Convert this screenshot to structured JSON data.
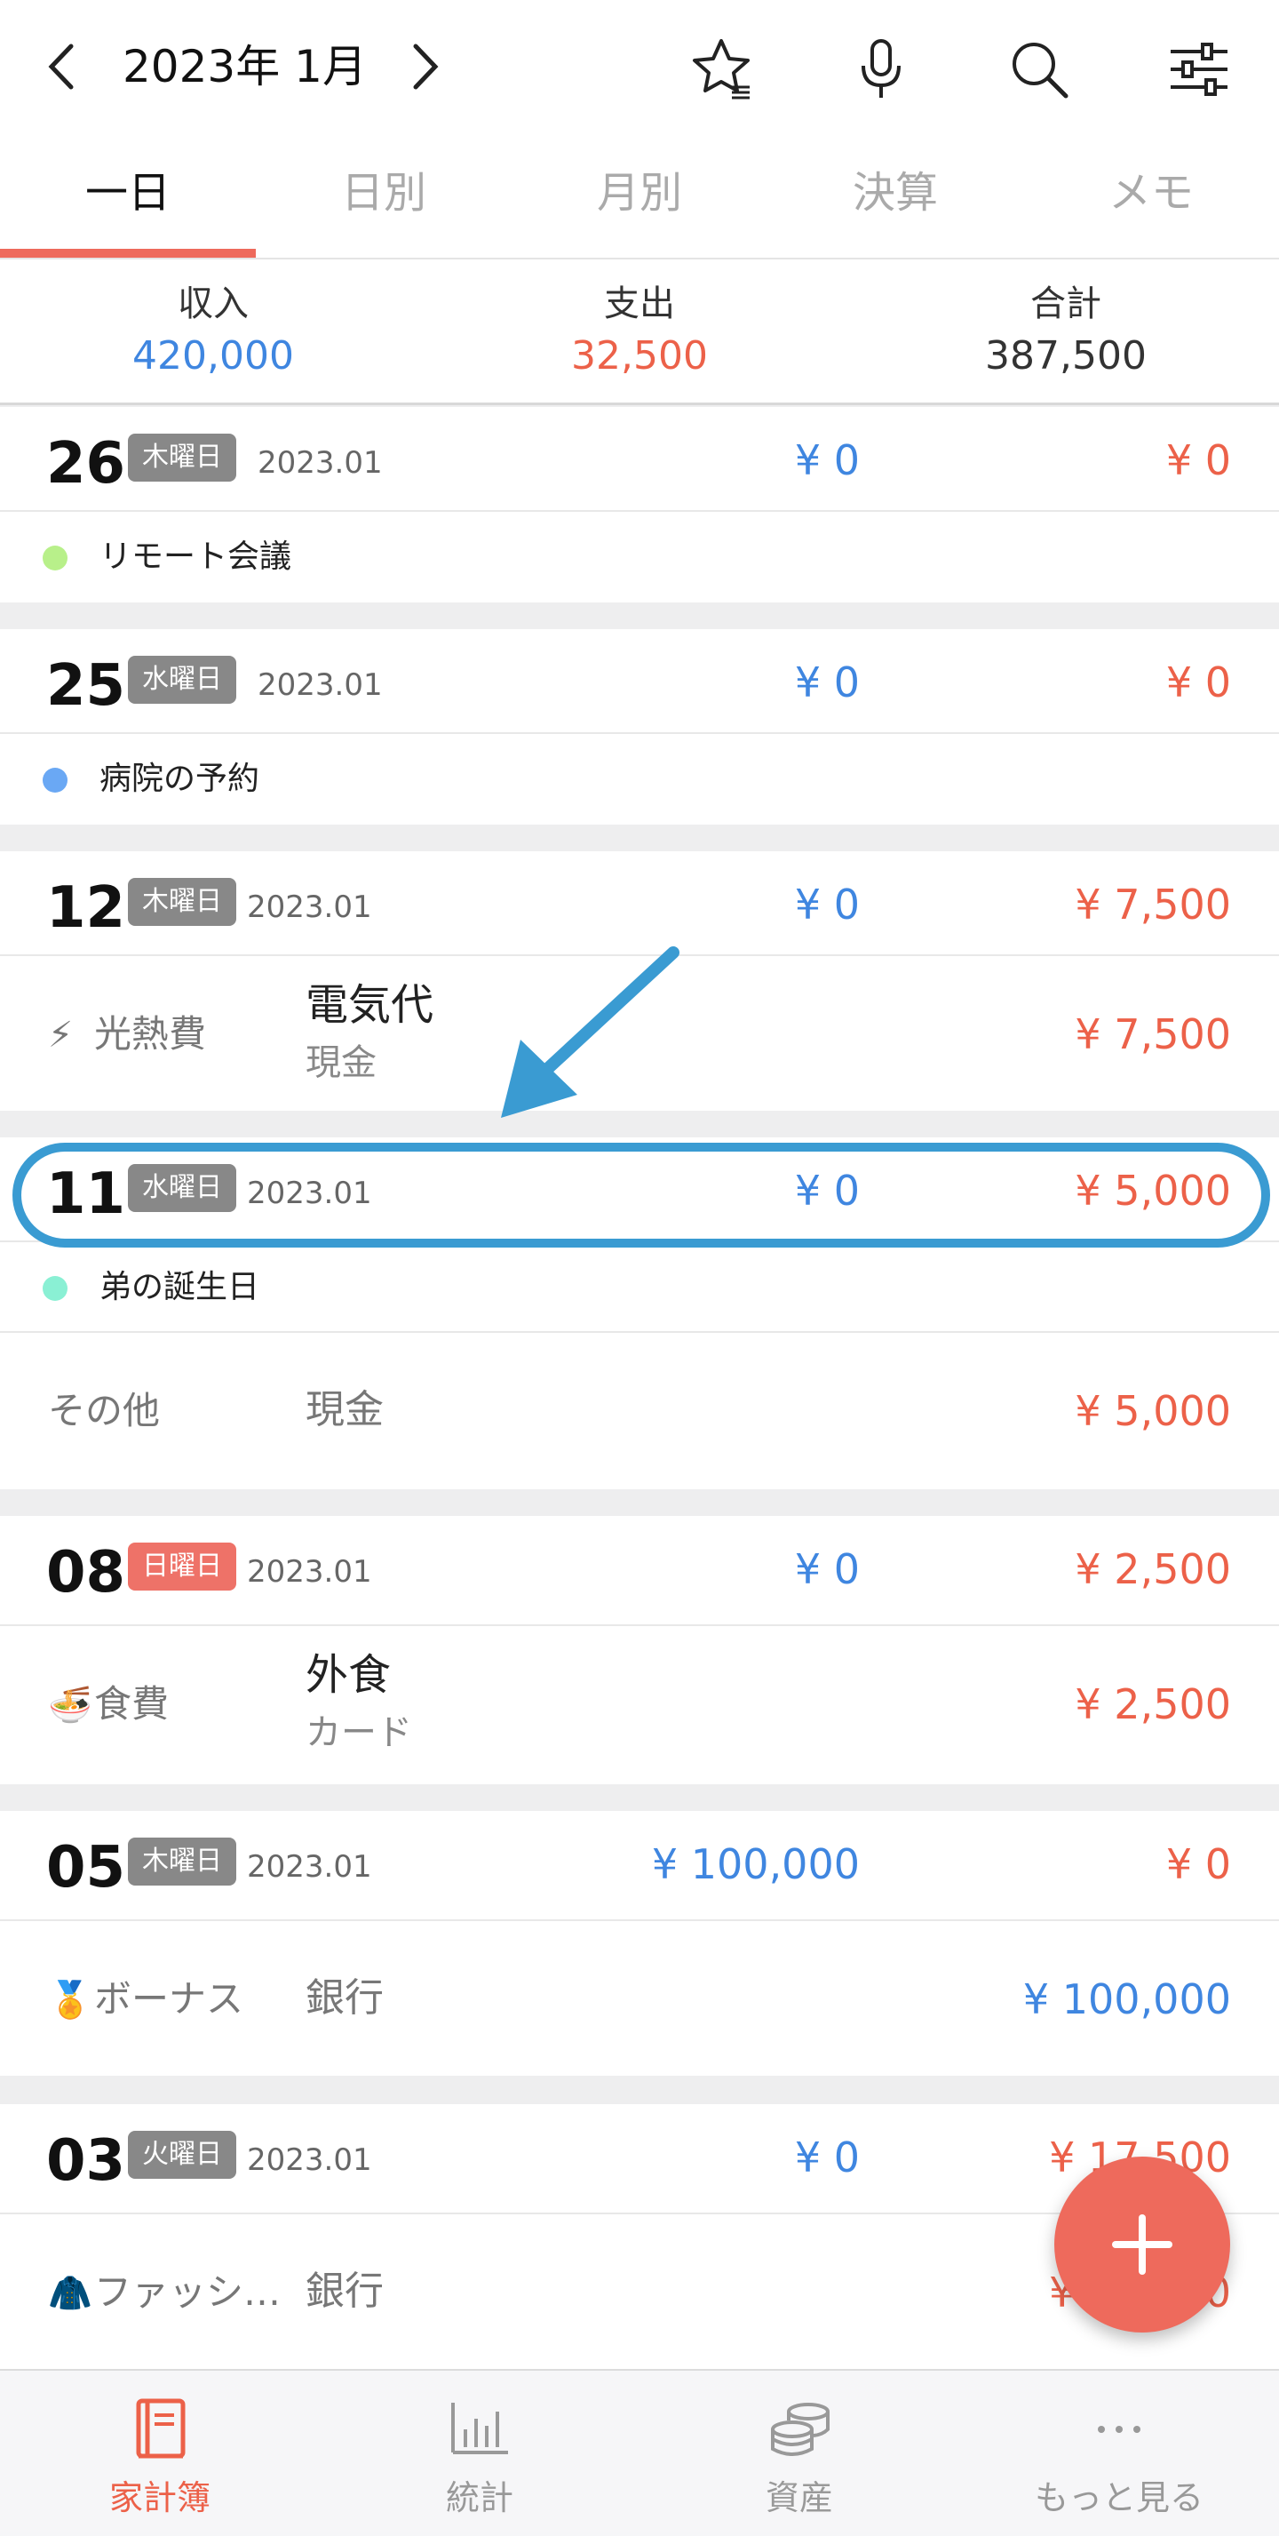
{
  "header": {
    "month": "2023年 1月"
  },
  "tabs": [
    {
      "label": "一日",
      "active": true
    },
    {
      "label": "日別",
      "active": false
    },
    {
      "label": "月別",
      "active": false
    },
    {
      "label": "決算",
      "active": false
    },
    {
      "label": "メモ",
      "active": false
    }
  ],
  "summary": {
    "income_label": "収入",
    "income": "420,000",
    "expense_label": "支出",
    "expense": "32,500",
    "total_label": "合計",
    "total": "387,500"
  },
  "days": [
    {
      "day": "26",
      "weekday": "木曜日",
      "ym": "2023.01",
      "income": "¥ 0",
      "expense": "¥ 0",
      "memo": {
        "text": "リモート会議",
        "color": "#b8f08a"
      }
    },
    {
      "day": "25",
      "weekday": "水曜日",
      "ym": "2023.01",
      "income": "¥ 0",
      "expense": "¥ 0",
      "memo": {
        "text": "病院の予約",
        "color": "#6aa8f4"
      }
    },
    {
      "day": "12",
      "weekday": "木曜日",
      "ym": "2023.01",
      "income": "¥ 0",
      "expense": "¥ 7,500",
      "tx": {
        "icon": "⚡",
        "category": "光熱費",
        "title": "電気代",
        "account": "現金",
        "amount": "¥ 7,500"
      }
    },
    {
      "day": "11",
      "weekday": "水曜日",
      "ym": "2023.01",
      "income": "¥ 0",
      "expense": "¥ 5,000",
      "memo": {
        "text": "弟の誕生日",
        "color": "#8af0d4"
      },
      "tx": {
        "category": "その他",
        "account": "現金",
        "amount": "¥ 5,000"
      }
    },
    {
      "day": "08",
      "weekday": "日曜日",
      "ym": "2023.01",
      "income": "¥ 0",
      "expense": "¥ 2,500",
      "tx": {
        "icon": "🍜",
        "category": "食費",
        "title": "外食",
        "account": "カード",
        "amount": "¥ 2,500"
      }
    },
    {
      "day": "05",
      "weekday": "木曜日",
      "ym": "2023.01",
      "income": "¥ 100,000",
      "expense": "¥ 0",
      "tx": {
        "icon": "🏅",
        "category": "ボーナス",
        "account": "銀行",
        "amount": "¥ 100,000"
      }
    },
    {
      "day": "03",
      "weekday": "火曜日",
      "ym": "2023.01",
      "income": "¥ 0",
      "expense": "¥ 17,500",
      "tx": {
        "icon": "🧥",
        "category": "ファッシ…",
        "account": "銀行",
        "amount": "¥ 17,500"
      }
    }
  ],
  "bottom_nav": [
    {
      "label": "家計簿",
      "icon": "book-icon",
      "active": true
    },
    {
      "label": "統計",
      "icon": "bar-chart-icon",
      "active": false
    },
    {
      "label": "資産",
      "icon": "coins-icon",
      "active": false
    },
    {
      "label": "もっと見る",
      "icon": "more-icon",
      "active": false
    }
  ],
  "colors": {
    "accent": "#ee6a5c",
    "income": "#3f86e0",
    "expense": "#ec6149",
    "annotation": "#3a9bd2"
  }
}
